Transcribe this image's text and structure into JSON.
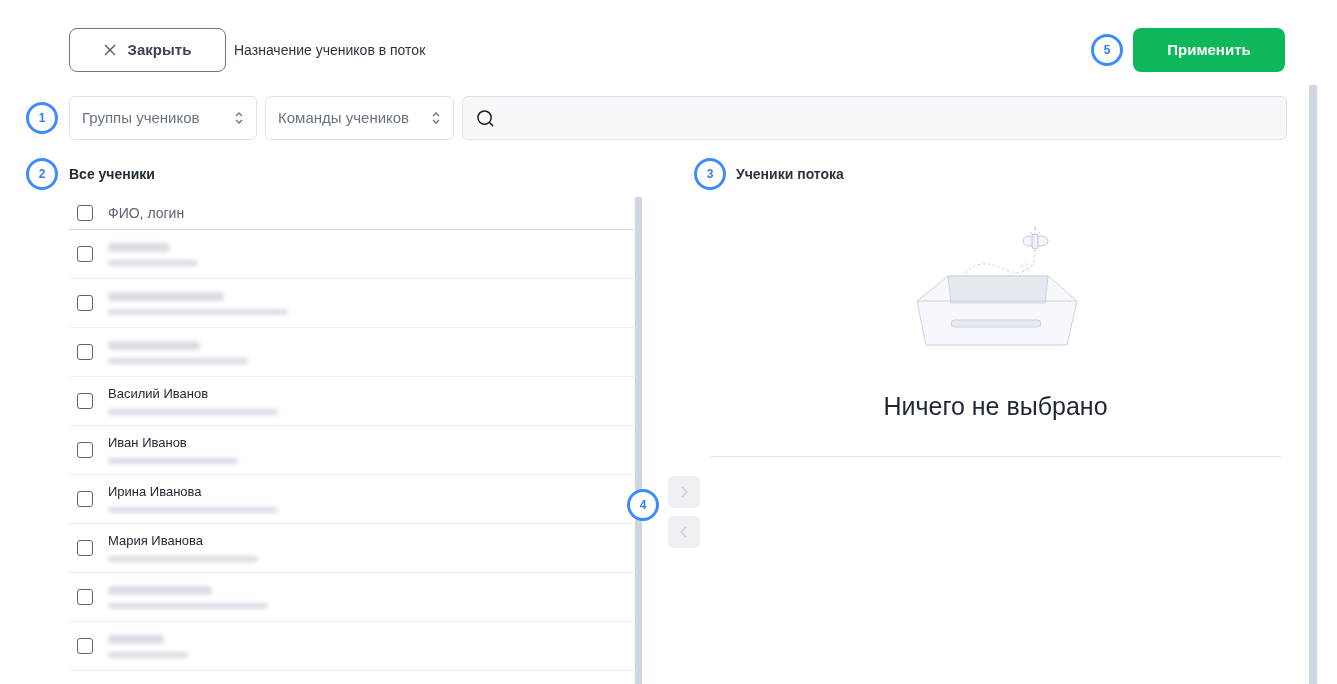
{
  "header": {
    "close_button": "Закрыть",
    "title": "Назначение учеников в поток",
    "apply_button": "Применить"
  },
  "markers": [
    "1",
    "2",
    "3",
    "4",
    "5"
  ],
  "filters": {
    "groups_select": "Группы учеников",
    "teams_select": "Команды учеников"
  },
  "all_students": {
    "title": "Все ученики",
    "header_checked": false,
    "column": "ФИО, логин",
    "rows": [
      {
        "kind": "blurred",
        "checked": false
      },
      {
        "kind": "blurred",
        "checked": false
      },
      {
        "kind": "blurred",
        "checked": false
      },
      {
        "kind": "named",
        "name": "Василий Иванов",
        "checked": false
      },
      {
        "kind": "named",
        "name": "Иван Иванов",
        "checked": false
      },
      {
        "kind": "named",
        "name": "Ирина Иванова",
        "checked": false
      },
      {
        "kind": "named",
        "name": "Мария Иванова",
        "checked": false
      },
      {
        "kind": "blurred",
        "checked": false
      },
      {
        "kind": "blurred",
        "checked": false
      }
    ]
  },
  "stream_students": {
    "title": "Ученики потока",
    "empty_text": "Ничего не выбрано"
  },
  "transfer": {
    "add_disabled": true,
    "remove_disabled": true
  }
}
